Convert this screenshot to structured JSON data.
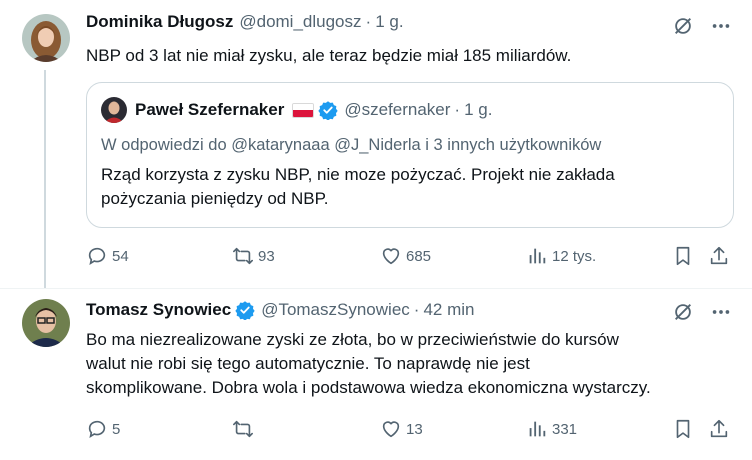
{
  "tweet1": {
    "author_name": "Dominika Długosz",
    "author_handle": "@domi_dlugosz",
    "separator": "·",
    "time": "1 g.",
    "text": "NBP od 3 lat nie miał zysku, ale teraz będzie miał 185 miliardów.",
    "quote": {
      "author_name": "Paweł Szefernaker",
      "author_handle": "@szefernaker",
      "separator": "·",
      "time": "1 g.",
      "reply_prefix": "W odpowiedzi do",
      "reply_mentions": "@katarynaaa @J_Niderla",
      "reply_suffix": "i 3 innych użytkowników",
      "text_line1": "Rząd korzysta z zysku NBP, nie moze pożyczać. Projekt nie zakłada",
      "text_line2": "pożyczania pieniędzy od NBP."
    },
    "actions": {
      "replies": "54",
      "reposts": "93",
      "likes": "685",
      "views": "12 tys."
    }
  },
  "tweet2": {
    "author_name": "Tomasz Synowiec",
    "author_handle": "@TomaszSynowiec",
    "separator": "·",
    "time": "42 min",
    "text_line1": "Bo ma niezrealizowane zyski ze złota, bo w przeciwieństwie do kursów",
    "text_line2": "walut nie robi się tego automatycznie. To naprawdę nie jest",
    "text_line3": "skomplikowane. Dobra wola i podstawowa wiedza ekonomiczna wystarczy.",
    "actions": {
      "replies": "5",
      "reposts": "",
      "likes": "13",
      "views": "331"
    }
  },
  "colors": {
    "verified": "#1d9bf0",
    "muted": "#536471",
    "text": "#0f1419",
    "border": "#cfd9de"
  },
  "icons": [
    "grok-icon",
    "more-icon",
    "reply-icon",
    "repost-icon",
    "like-icon",
    "views-icon",
    "bookmark-icon",
    "share-icon",
    "verified-icon"
  ]
}
